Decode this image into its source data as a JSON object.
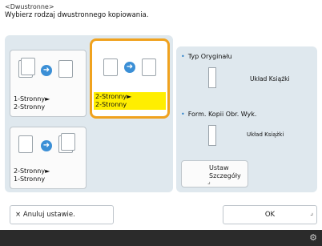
{
  "header": {
    "title": "<Dwustronne>",
    "subtitle": "Wybierz rodzaj dwustronnego kopiowania."
  },
  "options": [
    {
      "label": "1-Stronny►\n2-Stronny",
      "selected": false
    },
    {
      "label": "2-Stronny►\n2-Stronny",
      "selected": true
    },
    {
      "label": "2-Stronny►\n1-Stronny",
      "selected": false
    }
  ],
  "settings": {
    "original_type_title": "Typ Oryginału",
    "original_type_value": "Układ Książki",
    "output_format_title": "Form. Kopii Obr. Wyk.",
    "output_format_value": "Układ Książki",
    "details_button": "Ustaw\nSzczegóły"
  },
  "footer": {
    "cancel_label": "Anuluj ustawie.",
    "cancel_icon": "×",
    "ok_label": "OK"
  },
  "colors": {
    "selected_border": "#f0a21e",
    "selected_highlight": "#ffee00",
    "panel_bg": "#dfe8ee"
  }
}
